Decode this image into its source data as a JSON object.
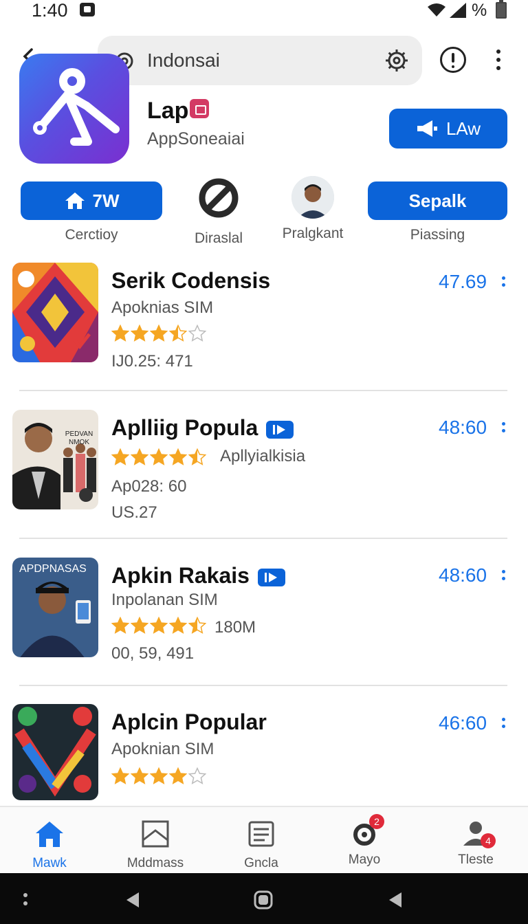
{
  "status_bar": {
    "time": "1:40",
    "battery_text": "%"
  },
  "search": {
    "text": "Indonsai"
  },
  "app": {
    "title": "Lap",
    "subtitle": "AppSoneaiai",
    "law_button": "LAw"
  },
  "actions": [
    {
      "label": "7W",
      "caption": "Cerctioy"
    },
    {
      "label": "",
      "caption": "Diraslal"
    },
    {
      "label": "",
      "caption": "Pralgkant"
    },
    {
      "label": "Sepalk",
      "caption": "Piassing"
    }
  ],
  "list": [
    {
      "title": "Serik Codensis",
      "line1": "Apoknias SIM",
      "rating_text": "",
      "line2": "IJ0.25: 471",
      "line3": "",
      "price": "47.69",
      "stars": 3.5
    },
    {
      "title": "Aplliig Popula",
      "line1": "Apllyialkisia",
      "rating_text": "",
      "line2": "Ap028:  60",
      "line3": "US.27",
      "price": "48:60",
      "stars": 4.5
    },
    {
      "title": "Apkin Rakais",
      "line1": "Inpolanan SIM",
      "rating_text": "180M",
      "line2": "00, 59, 491",
      "line3": "",
      "price": "48:60",
      "stars": 4.5
    },
    {
      "title": "Aplcin Popular",
      "line1": "Apoknian SIM",
      "rating_text": "",
      "line2": "",
      "line3": "",
      "price": "46:60",
      "stars": 4
    }
  ],
  "thumb_text": {
    "item1_corner": "",
    "item2_poster": "PEDVAN NMOK",
    "item3_banner": "APDPNASAS"
  },
  "bottom_nav": [
    {
      "label": "Mawk",
      "badge": ""
    },
    {
      "label": "Mddmass",
      "badge": ""
    },
    {
      "label": "Gncla",
      "badge": ""
    },
    {
      "label": "Mayo",
      "badge": "2"
    },
    {
      "label": "Tleste",
      "badge": "4"
    }
  ],
  "colors": {
    "primary": "#0b63d8",
    "price": "#1a73e8",
    "star": "#f5a623",
    "active_nav": "#1a73e8"
  }
}
